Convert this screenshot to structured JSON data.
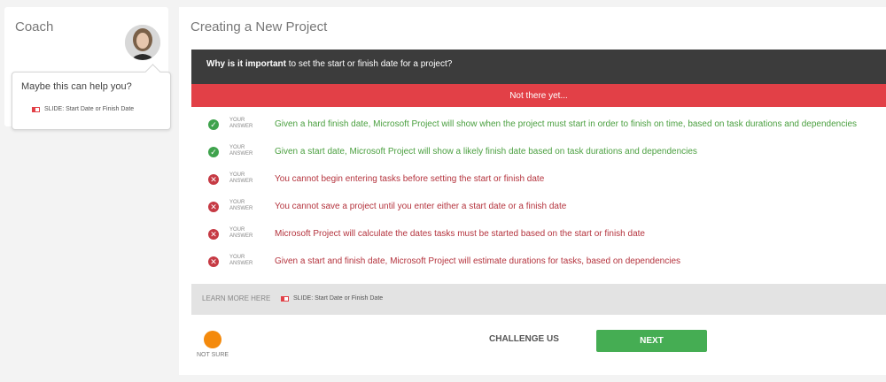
{
  "coach": {
    "title": "Coach",
    "bubble_text": "Maybe this can help you?",
    "slide_link": "SLIDE: Start Date or Finish Date"
  },
  "main": {
    "title": "Creating a New Project",
    "question_bold": "Why is it important",
    "question_rest": " to set the start or finish date for a project?",
    "feedback": "Not there yet...",
    "your_answer_label": "YOUR ANSWER",
    "answers": [
      {
        "status": "correct",
        "text": "Given a hard finish date, Microsoft Project will show when the project must start in order to finish on time, based on task durations and dependencies"
      },
      {
        "status": "correct",
        "text": "Given a start date, Microsoft Project will show a likely finish date based on task durations and dependencies"
      },
      {
        "status": "wrong",
        "text": "You cannot begin entering tasks before setting the start or finish date"
      },
      {
        "status": "wrong",
        "text": "You cannot save a project until you enter either a start date or a finish date"
      },
      {
        "status": "wrong",
        "text": "Microsoft Project will calculate the dates tasks must be started based on the start or finish date"
      },
      {
        "status": "wrong",
        "text": "Given a start and finish date, Microsoft Project will estimate durations for tasks, based on dependencies"
      }
    ],
    "learn_more_label": "LEARN MORE HERE",
    "learn_more_link": "SLIDE: Start Date or Finish Date"
  },
  "footer": {
    "not_sure": "NOT SURE",
    "challenge": "CHALLENGE US",
    "next": "NEXT"
  },
  "colors": {
    "question_bg": "#3c3c3c",
    "feedback_bg": "#e24047",
    "correct": "#4a9f3f",
    "wrong": "#b4333d",
    "next_bg": "#45ad53",
    "not_sure": "#f48a0c"
  }
}
